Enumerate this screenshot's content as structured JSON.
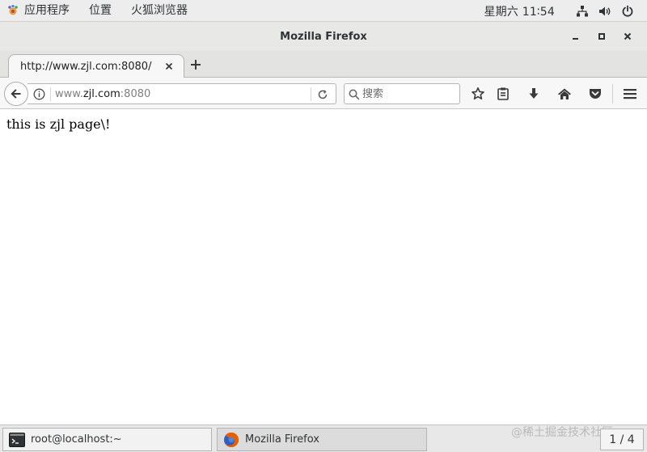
{
  "topbar": {
    "apps_label": "应用程序",
    "places_label": "位置",
    "firefox_label": "火狐浏览器",
    "clock": "星期六 11∶54"
  },
  "window": {
    "title": "Mozilla Firefox"
  },
  "tabs": [
    {
      "label": "http://www.zjl.com:8080/"
    }
  ],
  "navbar": {
    "url_prefix": "www.",
    "url_host": "zjl.com",
    "url_suffix": ":8080",
    "search_placeholder": "搜索"
  },
  "page": {
    "text": "this is zjl page\\!"
  },
  "taskbar": {
    "items": [
      {
        "label": "root@localhost:~"
      },
      {
        "label": "Mozilla Firefox"
      }
    ],
    "pager": "1 / 4",
    "watermark": "@稀土掘金技术社区"
  },
  "colors": {
    "firefox_orange": "#e66000",
    "firefox_blue": "#2f5ec4"
  }
}
